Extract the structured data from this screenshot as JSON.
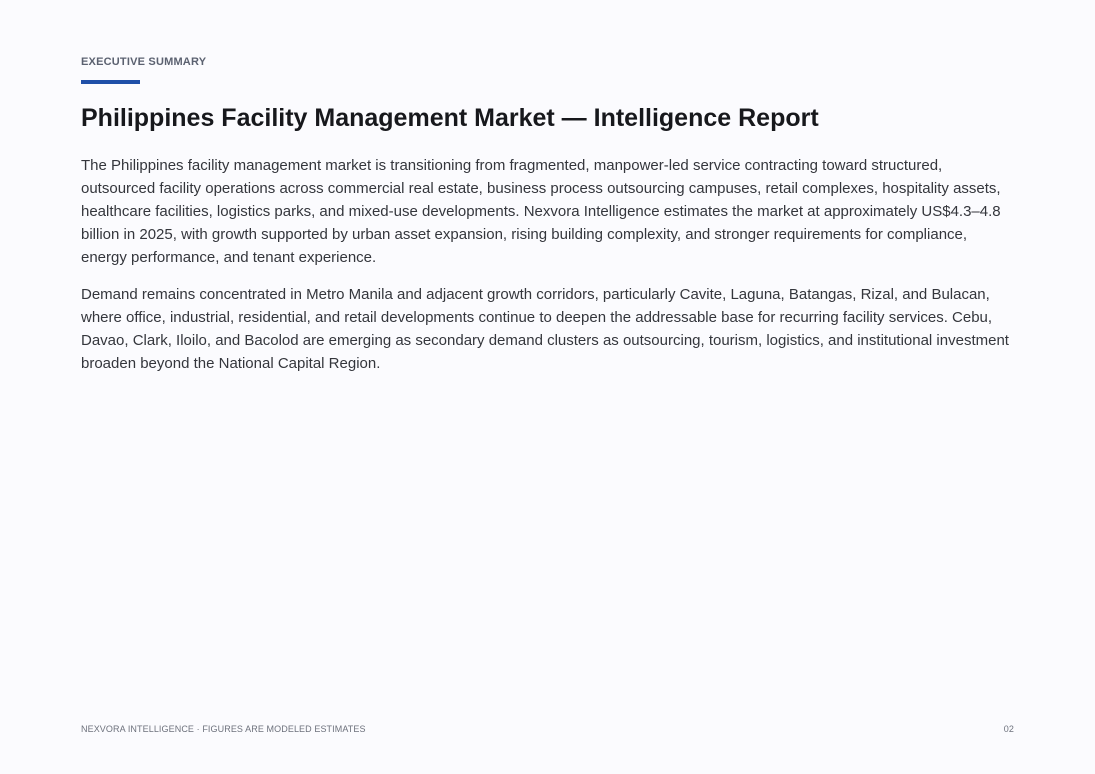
{
  "header": {
    "eyebrow": "EXECUTIVE SUMMARY",
    "accent_color": "#1f4fa8"
  },
  "title": "Philippines Facility Management Market — Intelligence Report",
  "paragraphs": [
    "The Philippines facility management market is transitioning from fragmented, manpower-led service contracting toward structured, outsourced facility operations across commercial real estate, business process outsourcing campuses, retail complexes, hospitality assets, healthcare facilities, logistics parks, and mixed-use developments. Nexvora Intelligence estimates the market at approximately US$4.3–4.8 billion in 2025, with growth supported by urban asset expansion, rising building complexity, and stronger requirements for compliance, energy performance, and tenant experience.",
    "Demand remains concentrated in Metro Manila and adjacent growth corridors, particularly Cavite, Laguna, Batangas, Rizal, and Bulacan, where office, industrial, residential, and retail developments continue to deepen the addressable base for recurring facility services. Cebu, Davao, Clark, Iloilo, and Bacolod are emerging as secondary demand clusters as outsourcing, tourism, logistics, and institutional investment broaden beyond the National Capital Region."
  ],
  "footer": {
    "left": "NEXVORA INTELLIGENCE  ·  FIGURES ARE MODELED ESTIMATES",
    "page_number": "02"
  }
}
